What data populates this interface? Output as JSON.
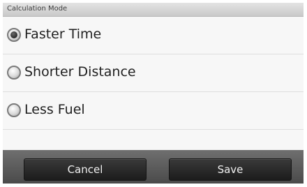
{
  "header": {
    "title": "Calculation Mode"
  },
  "options": [
    {
      "label": "Faster Time",
      "selected": true,
      "icon": "radio-selected-icon"
    },
    {
      "label": "Shorter Distance",
      "selected": false,
      "icon": "radio-unselected-icon"
    },
    {
      "label": "Less Fuel",
      "selected": false,
      "icon": "radio-unselected-icon"
    }
  ],
  "footer": {
    "cancel_label": "Cancel",
    "save_label": "Save"
  },
  "colors": {
    "header_bg": "#d6d6d6",
    "footer_bg": "#5c5c5c",
    "button_bg": "#2a2a2a",
    "button_text": "#f0f0f0",
    "list_bg": "#f7f7f7"
  }
}
